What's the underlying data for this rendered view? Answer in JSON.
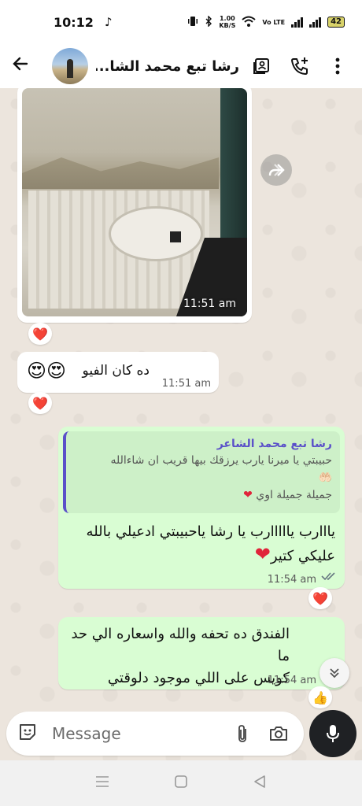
{
  "status_bar": {
    "time": "10:12",
    "net_speed_value": "1.00",
    "net_speed_unit": "KB/S",
    "volte": "Vo LTE",
    "battery": "42"
  },
  "header": {
    "contact_name": "رشا تبع محمد الشا..."
  },
  "messages": {
    "image_msg": {
      "time": "11:51 am",
      "reaction": "❤️"
    },
    "video_msg": {
      "text": "ده كان الفيو",
      "emojis": "😍😍",
      "time": "11:51 am",
      "reaction": "❤️"
    },
    "reply_msg": {
      "quote_author": "رشا تبع محمد الشاعر",
      "quote_line1": "حبيبتي يا ميرنا يارب يرزقك بيها قريب ان شاءالله",
      "quote_line2": "🤲🏻",
      "quote_line3": "جميلة جميلة اوي",
      "text_line1": "يااارب يااااارب يا رشا ياحبيبتي ادعيلي بالله",
      "text_line2": "عليكي كتير",
      "time": "11:54 am",
      "reaction": "❤️"
    },
    "hotel_msg": {
      "text_line1": "الفندق ده تحفه والله واسعاره الي حد ما",
      "text_line2": "كويس على اللي موجود دلوقتي",
      "time": "11:54 am",
      "reaction": "👍"
    }
  },
  "input": {
    "placeholder": "Message"
  },
  "colors": {
    "outgoing_bubble": "#d9fdd3",
    "incoming_bubble": "#ffffff",
    "chat_background": "#ece5dd",
    "quote_accent": "#5b50c9",
    "mic_button": "#1f2124"
  }
}
